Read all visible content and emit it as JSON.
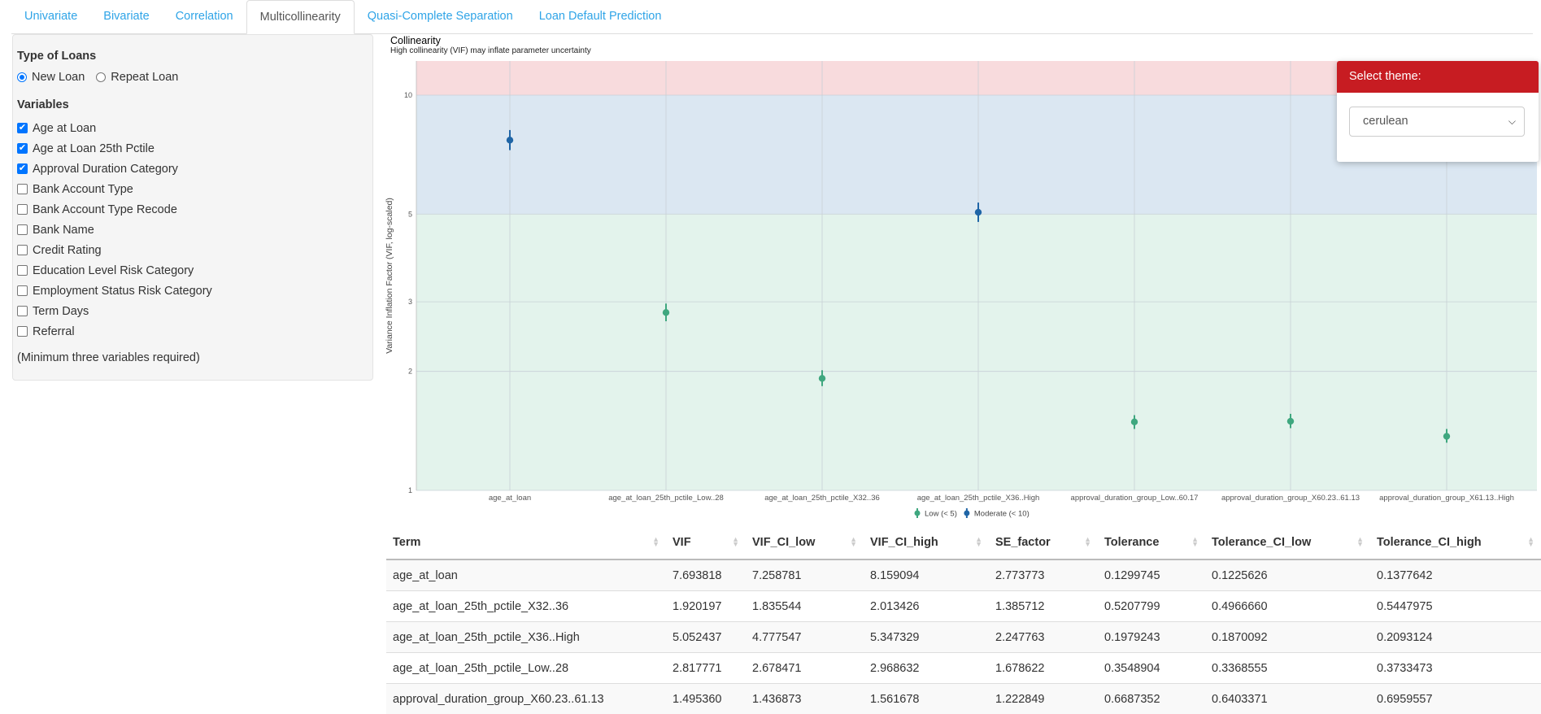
{
  "tabs": [
    {
      "label": "Univariate",
      "active": false
    },
    {
      "label": "Bivariate",
      "active": false
    },
    {
      "label": "Correlation",
      "active": false
    },
    {
      "label": "Multicollinearity",
      "active": true
    },
    {
      "label": "Quasi-Complete Separation",
      "active": false
    },
    {
      "label": "Loan Default Prediction",
      "active": false
    }
  ],
  "sidebar": {
    "loan_type_label": "Type of Loans",
    "loan_types": [
      {
        "label": "New Loan",
        "selected": true
      },
      {
        "label": "Repeat Loan",
        "selected": false
      }
    ],
    "variables_label": "Variables",
    "variables": [
      {
        "label": "Age at Loan",
        "checked": true
      },
      {
        "label": "Age at Loan 25th Pctile",
        "checked": true
      },
      {
        "label": "Approval Duration Category",
        "checked": true
      },
      {
        "label": "Bank Account Type",
        "checked": false
      },
      {
        "label": "Bank Account Type Recode",
        "checked": false
      },
      {
        "label": "Bank Name",
        "checked": false
      },
      {
        "label": "Credit Rating",
        "checked": false
      },
      {
        "label": "Education Level Risk Category",
        "checked": false
      },
      {
        "label": "Employment Status Risk Category",
        "checked": false
      },
      {
        "label": "Term Days",
        "checked": false
      },
      {
        "label": "Referral",
        "checked": false
      }
    ],
    "hint": "(Minimum three variables required)"
  },
  "plot": {
    "title": "Collinearity",
    "subtitle": "High collinearity (VIF) may inflate parameter uncertainty"
  },
  "chart_data": {
    "type": "scatter",
    "title": "Collinearity",
    "subtitle": "High collinearity (VIF) may inflate parameter uncertainty",
    "xlabel": "",
    "ylabel": "Variance Inflation Factor (VIF, log-scaled)",
    "y_scale": "log",
    "ylim": [
      1,
      12.2
    ],
    "yticks": [
      1,
      2,
      3,
      5,
      10
    ],
    "bands": [
      {
        "from": 1,
        "to": 5,
        "color": "#e3f3ec"
      },
      {
        "from": 5,
        "to": 10,
        "color": "#dbe7f2"
      },
      {
        "from": 10,
        "to": 12.2,
        "color": "#f8dbdd"
      }
    ],
    "categories": [
      "age_at_loan",
      "age_at_loan_25th_pctile_Low..28",
      "age_at_loan_25th_pctile_X32..36",
      "age_at_loan_25th_pctile_X36..High",
      "approval_duration_group_Low..60.17",
      "approval_duration_group_X60.23..61.13",
      "approval_duration_group_X61.13..High"
    ],
    "values": [
      7.693818,
      2.817771,
      1.920197,
      5.052437,
      1.49,
      1.49536,
      1.37
    ],
    "ci_low": [
      7.258781,
      2.678471,
      1.835544,
      4.777547,
      1.43,
      1.436873,
      1.32
    ],
    "ci_high": [
      8.159094,
      2.968632,
      2.013426,
      5.347329,
      1.55,
      1.561678,
      1.43
    ],
    "groups": [
      "Moderate (< 10)",
      "Low (< 5)",
      "Low (< 5)",
      "Moderate (< 10)",
      "Low (< 5)",
      "Low (< 5)",
      "Low (< 5)"
    ],
    "legend": [
      {
        "name": "Low (< 5)",
        "color": "#3fa77f"
      },
      {
        "name": "Moderate (< 10)",
        "color": "#1f65a6"
      }
    ],
    "legend_position": "bottom",
    "grid": true
  },
  "theme": {
    "header": "Select theme:",
    "selected": "cerulean"
  },
  "table": {
    "columns": [
      "Term",
      "VIF",
      "VIF_CI_low",
      "VIF_CI_high",
      "SE_factor",
      "Tolerance",
      "Tolerance_CI_low",
      "Tolerance_CI_high"
    ],
    "rows": [
      [
        "age_at_loan",
        "7.693818",
        "7.258781",
        "8.159094",
        "2.773773",
        "0.1299745",
        "0.1225626",
        "0.1377642"
      ],
      [
        "age_at_loan_25th_pctile_X32..36",
        "1.920197",
        "1.835544",
        "2.013426",
        "1.385712",
        "0.5207799",
        "0.4966660",
        "0.5447975"
      ],
      [
        "age_at_loan_25th_pctile_X36..High",
        "5.052437",
        "4.777547",
        "5.347329",
        "2.247763",
        "0.1979243",
        "0.1870092",
        "0.2093124"
      ],
      [
        "age_at_loan_25th_pctile_Low..28",
        "2.817771",
        "2.678471",
        "2.968632",
        "1.678622",
        "0.3548904",
        "0.3368555",
        "0.3733473"
      ],
      [
        "approval_duration_group_X60.23..61.13",
        "1.495360",
        "1.436873",
        "1.561678",
        "1.222849",
        "0.6687352",
        "0.6403371",
        "0.6959557"
      ]
    ]
  }
}
